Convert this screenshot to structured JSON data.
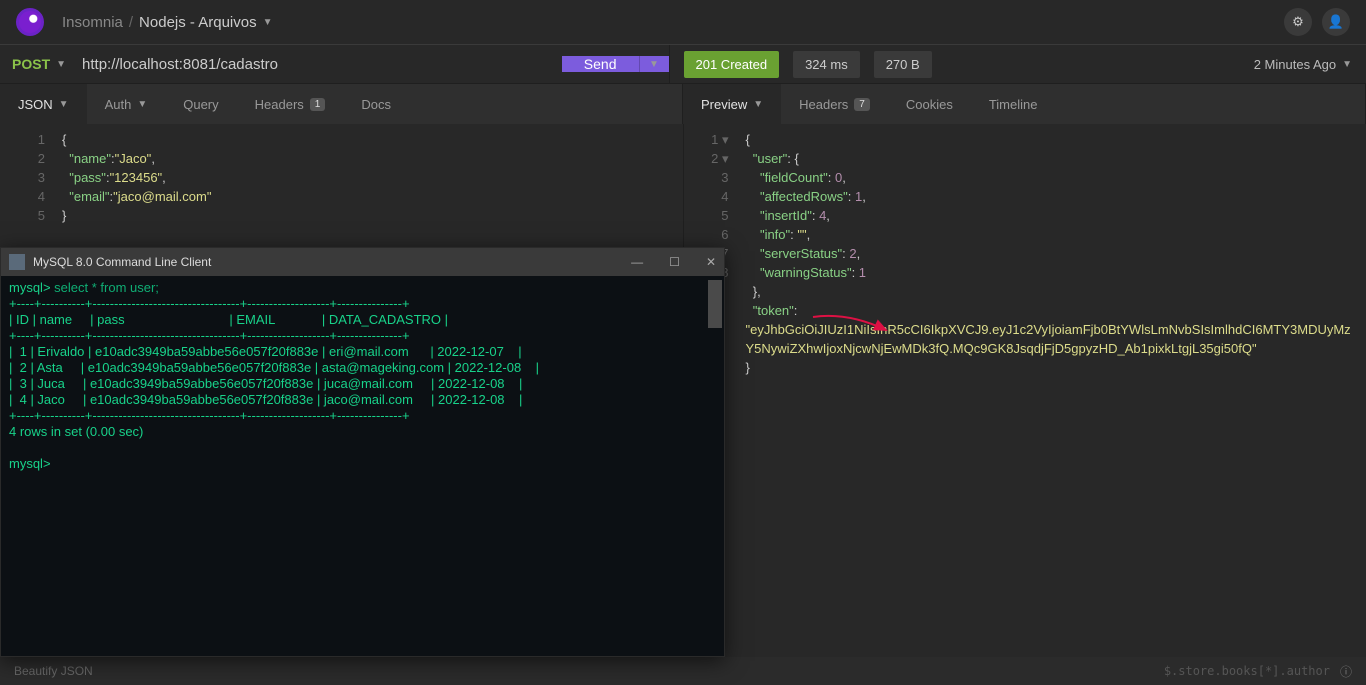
{
  "breadcrumb": {
    "app": "Insomnia",
    "workspace": "Nodejs - Arquivos"
  },
  "request": {
    "method": "POST",
    "url": "http://localhost:8081/cadastro",
    "send_label": "Send"
  },
  "response": {
    "status": "201 Created",
    "time": "324 ms",
    "size": "270 B",
    "ago": "2 Minutes Ago"
  },
  "tabs_left": {
    "body": "JSON",
    "auth": "Auth",
    "query": "Query",
    "headers": "Headers",
    "headers_count": "1",
    "docs": "Docs"
  },
  "tabs_right": {
    "preview": "Preview",
    "headers": "Headers",
    "headers_count": "7",
    "cookies": "Cookies",
    "timeline": "Timeline"
  },
  "req_body": {
    "name_key": "\"name\"",
    "name_val": "\"Jaco\"",
    "pass_key": "\"pass\"",
    "pass_val": "\"123456\"",
    "email_key": "\"email\"",
    "email_val": "\"jaco@mail.com\""
  },
  "resp_body": {
    "user_key": "\"user\"",
    "fieldCount_key": "\"fieldCount\"",
    "fieldCount_val": "0",
    "affectedRows_key": "\"affectedRows\"",
    "affectedRows_val": "1",
    "insertId_key": "\"insertId\"",
    "insertId_val": "4",
    "info_key": "\"info\"",
    "info_val": "\"\"",
    "serverStatus_key": "\"serverStatus\"",
    "serverStatus_val": "2",
    "warningStatus_key": "\"warningStatus\"",
    "warningStatus_val": "1",
    "token_key": "\"token\"",
    "token_val": "\"eyJhbGciOiJIUzI1NiIsInR5cCI6IkpXVCJ9.eyJ1c2VyIjoiamFjb0BtYWlsLmNvbSIsImlhdCI6MTY3MDUyMzY5NywiZXhwIjoxNjcwNjEwMDk3fQ.MQc9GK8JsqdjFjD5gpyzHD_Ab1pixkLtgjL35gi50fQ\""
  },
  "mysql": {
    "title": "MySQL 8.0 Command Line Client",
    "prompt": "mysql>",
    "query": " select * from user;",
    "sep": "+----+----------+----------------------------------+-------------------+---------------+",
    "header": "| ID | name     | pass                             | EMAIL             | DATA_CADASTRO |",
    "rows": [
      "|  1 | Erivaldo | e10adc3949ba59abbe56e057f20f883e | eri@mail.com      | 2022-12-07    |",
      "|  2 | Asta     | e10adc3949ba59abbe56e057f20f883e | asta@mageking.com | 2022-12-08    |",
      "|  3 | Juca     | e10adc3949ba59abbe56e057f20f883e | juca@mail.com     | 2022-12-08    |",
      "|  4 | Jaco     | e10adc3949ba59abbe56e057f20f883e | jaco@mail.com     | 2022-12-08    |"
    ],
    "footer": "4 rows in set (0.00 sec)"
  },
  "footer": {
    "beautify": "Beautify JSON",
    "hint": "$.store.books[*].author"
  }
}
